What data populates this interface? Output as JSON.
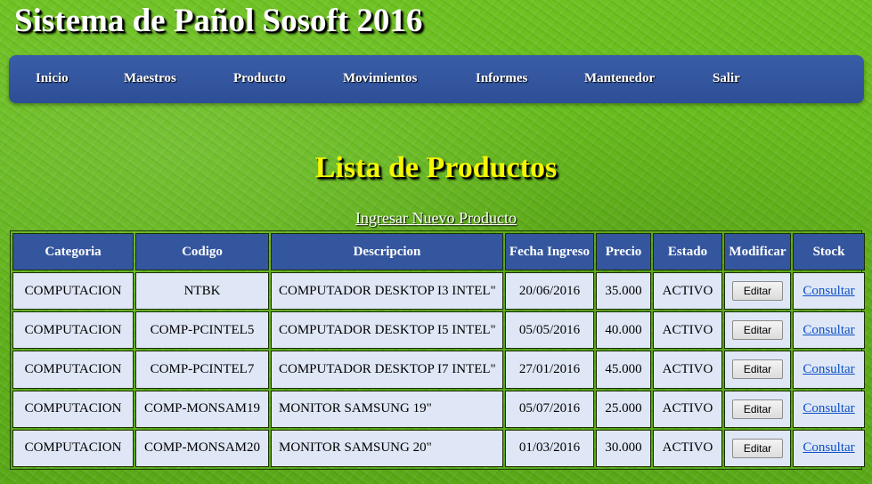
{
  "site": {
    "title": "Sistema de Pañol Sosoft 2016"
  },
  "nav": {
    "items": [
      {
        "label": "Inicio"
      },
      {
        "label": "Maestros"
      },
      {
        "label": "Producto"
      },
      {
        "label": "Movimientos"
      },
      {
        "label": "Informes"
      },
      {
        "label": "Mantenedor"
      },
      {
        "label": "Salir"
      }
    ]
  },
  "main": {
    "heading": "Lista de Productos",
    "add_link": "Ingresar Nuevo Producto"
  },
  "table": {
    "headers": [
      "Categoria",
      "Codigo",
      "Descripcion",
      "Fecha Ingreso",
      "Precio",
      "Estado",
      "Modificar",
      "Stock"
    ],
    "edit_label": "Editar",
    "stock_label": "Consultar",
    "rows": [
      {
        "categoria": "COMPUTACION",
        "codigo": "NTBK",
        "descripcion": "COMPUTADOR DESKTOP I3 INTEL\"",
        "fecha": "20/06/2016",
        "precio": "35.000",
        "estado": "ACTIVO"
      },
      {
        "categoria": "COMPUTACION",
        "codigo": "COMP-PCINTEL5",
        "descripcion": "COMPUTADOR DESKTOP I5 INTEL\"",
        "fecha": "05/05/2016",
        "precio": "40.000",
        "estado": "ACTIVO"
      },
      {
        "categoria": "COMPUTACION",
        "codigo": "COMP-PCINTEL7",
        "descripcion": "COMPUTADOR DESKTOP I7 INTEL\"",
        "fecha": "27/01/2016",
        "precio": "45.000",
        "estado": "ACTIVO"
      },
      {
        "categoria": "COMPUTACION",
        "codigo": "COMP-MONSAM19",
        "descripcion": "MONITOR SAMSUNG 19\"",
        "fecha": "05/07/2016",
        "precio": "25.000",
        "estado": "ACTIVO"
      },
      {
        "categoria": "COMPUTACION",
        "codigo": "COMP-MONSAM20",
        "descripcion": "MONITOR SAMSUNG 20\"",
        "fecha": "01/03/2016",
        "precio": "30.000",
        "estado": "ACTIVO"
      }
    ]
  }
}
